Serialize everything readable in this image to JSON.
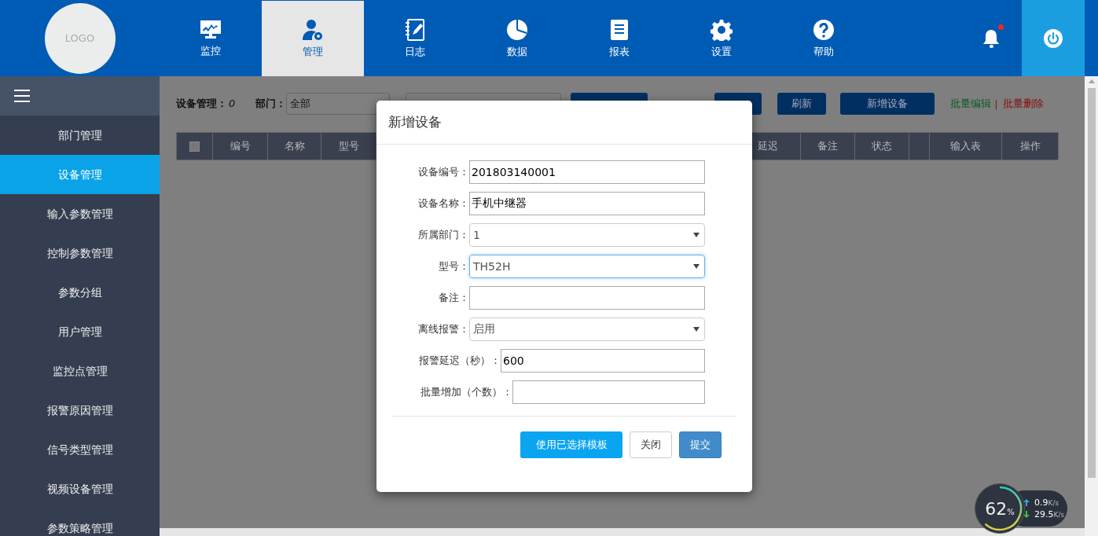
{
  "header": {
    "logo": "LOGO",
    "nav": [
      {
        "label": "监控",
        "selected": false
      },
      {
        "label": "管理",
        "selected": true
      },
      {
        "label": "日志",
        "selected": false
      },
      {
        "label": "数据",
        "selected": false
      },
      {
        "label": "报表",
        "selected": false
      },
      {
        "label": "设置",
        "selected": false
      },
      {
        "label": "帮助",
        "selected": false
      }
    ],
    "notification": true
  },
  "sidebar": {
    "items": [
      {
        "label": "部门管理",
        "selected": false
      },
      {
        "label": "设备管理",
        "selected": true
      },
      {
        "label": "输入参数管理",
        "selected": false
      },
      {
        "label": "控制参数管理",
        "selected": false
      },
      {
        "label": "参数分组",
        "selected": false
      },
      {
        "label": "用户管理",
        "selected": false
      },
      {
        "label": "监控点管理",
        "selected": false
      },
      {
        "label": "报警原因管理",
        "selected": false
      },
      {
        "label": "信号类型管理",
        "selected": false
      },
      {
        "label": "视频设备管理",
        "selected": false
      },
      {
        "label": "参数策略管理",
        "selected": false
      }
    ]
  },
  "toolbar": {
    "title": "设备管理：",
    "count": "0",
    "department_label": "部门：",
    "department_value": "全部",
    "refresh": "刷新",
    "add": "新增设备",
    "batch_edit": "批量编辑",
    "separator": "|",
    "batch_delete": "批量删除"
  },
  "table": {
    "select_all_checked": false,
    "columns": [
      "编号",
      "名称",
      "型号",
      "延迟",
      "备注",
      "状态",
      "输入表",
      "操作"
    ]
  },
  "dialog": {
    "title": "新增设备",
    "fields": [
      {
        "kind": "input",
        "label": "设备编号：",
        "value": "201803140001",
        "focused": false
      },
      {
        "kind": "input",
        "label": "设备名称：",
        "value": "手机中继器",
        "focused": false
      },
      {
        "kind": "select",
        "label": "所属部门：",
        "value": "1",
        "focused": false
      },
      {
        "kind": "select",
        "label": "型号：",
        "value": "TH52H",
        "focused": true
      },
      {
        "kind": "input",
        "label": "备注：",
        "focused": false
      },
      {
        "kind": "select",
        "label": "离线报警：",
        "value": "启用",
        "focused": false
      },
      {
        "kind": "input",
        "label": "报警延迟（秒）：",
        "value": "600",
        "focused": false
      },
      {
        "kind": "input",
        "label": "批量增加（个数）：",
        "focused": false
      }
    ],
    "buttons": [
      {
        "label": "使用已选择模板",
        "kind": "info"
      },
      {
        "label": "关闭",
        "kind": "default"
      },
      {
        "label": "提交",
        "kind": "primary"
      }
    ]
  },
  "network_widget": {
    "percent": "62",
    "percent_unit": "%",
    "upload": "0.9",
    "upload_unit": "K/s",
    "download": "29.5",
    "download_unit": "K/s"
  }
}
